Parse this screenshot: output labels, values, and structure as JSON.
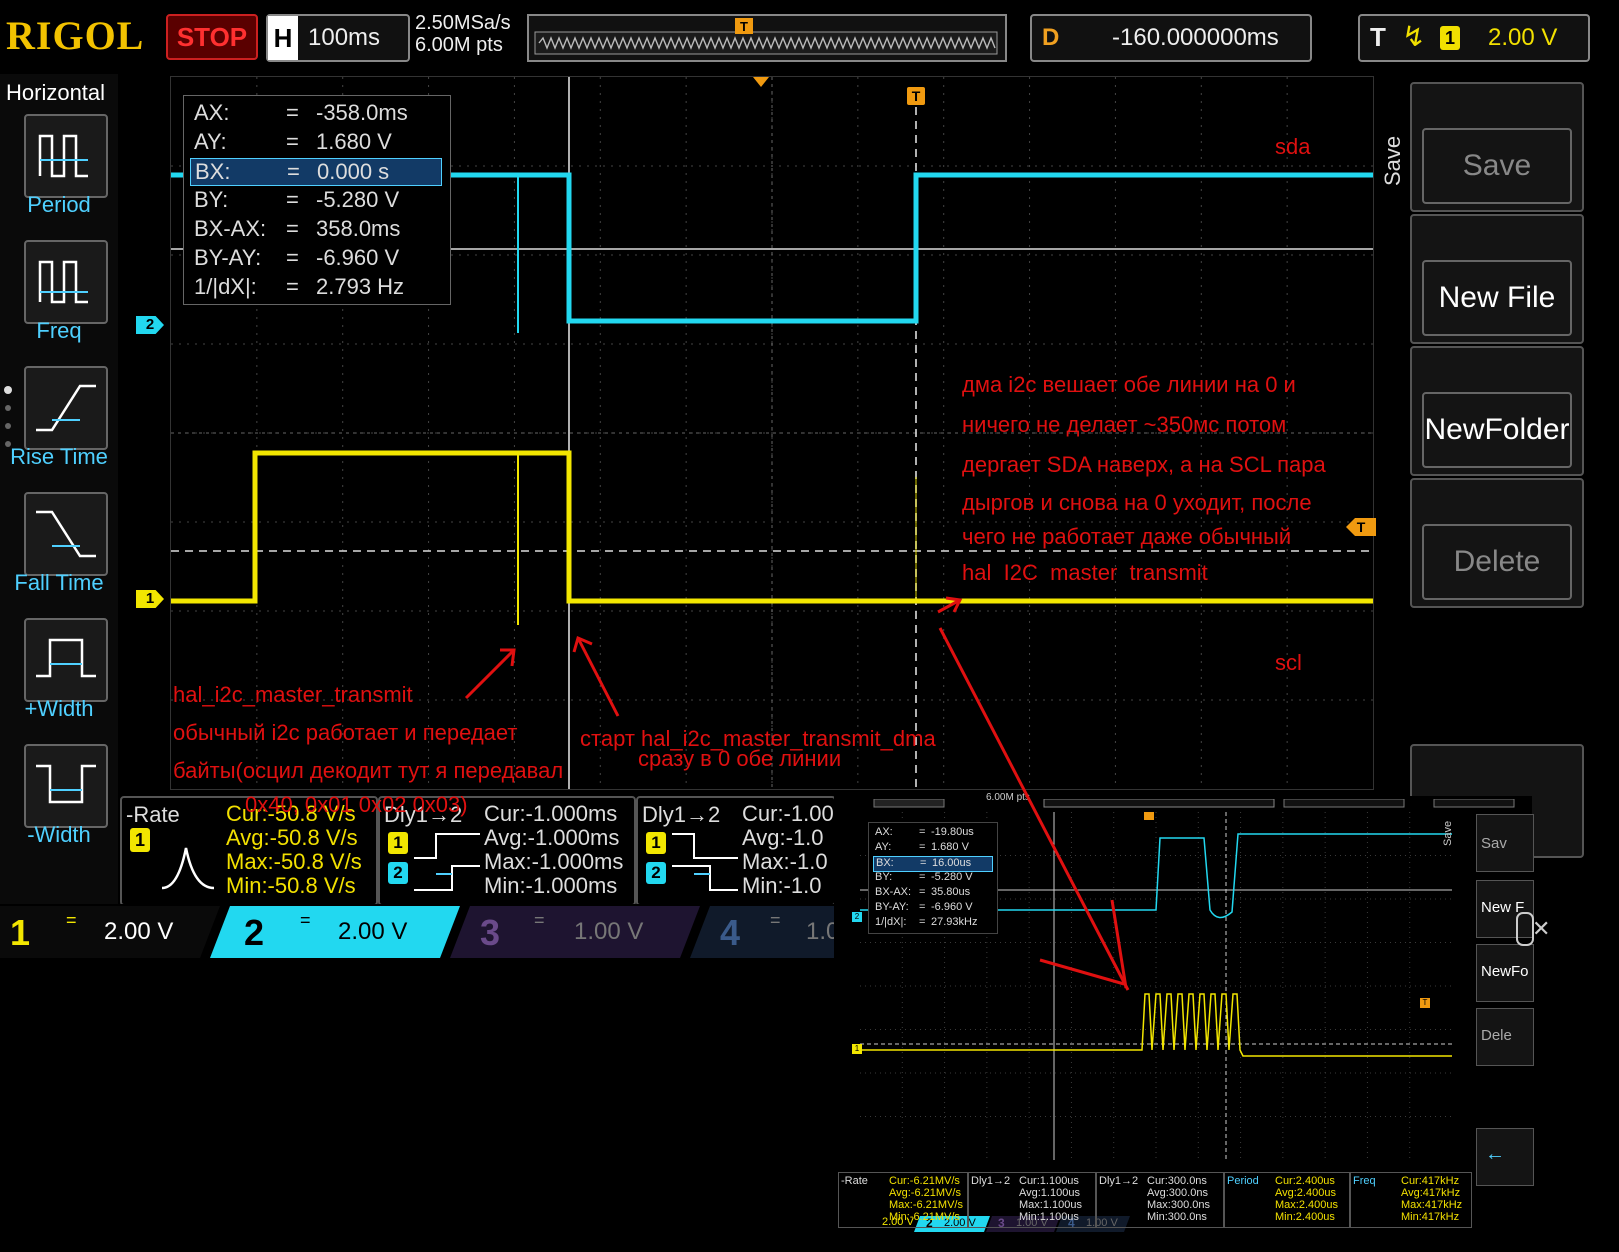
{
  "topbar": {
    "logo": "RIGOL",
    "run_state": "STOP",
    "h_key": "H",
    "timebase": "100ms",
    "sample_rate": "2.50MSa/s",
    "memory_depth": "6.00M pts",
    "d_key": "D",
    "delay": "-160.000000ms",
    "t_key": "T",
    "trigger_channel": "1",
    "trigger_level": "2.00 V"
  },
  "left_menu": {
    "title": "Horizontal",
    "items": [
      {
        "label": "Period"
      },
      {
        "label": "Freq"
      },
      {
        "label": "Rise Time"
      },
      {
        "label": "Fall Time"
      },
      {
        "label": "+Width"
      },
      {
        "label": "-Width"
      }
    ]
  },
  "cursors": {
    "rows": [
      {
        "k": "AX:",
        "v": "-358.0ms"
      },
      {
        "k": "AY:",
        "v": "1.680 V"
      },
      {
        "k": "BX:",
        "v": "0.000 s"
      },
      {
        "k": "BY:",
        "v": "-5.280 V"
      },
      {
        "k": "BX-AX:",
        "v": "358.0ms"
      },
      {
        "k": "BY-AY:",
        "v": "-6.960 V"
      },
      {
        "k": "1/|dX|:",
        "v": "2.793 Hz"
      }
    ],
    "eq": "="
  },
  "right_menu": {
    "title": "Save",
    "items": [
      {
        "label": "Save"
      },
      {
        "label": "New File"
      },
      {
        "label": "NewFolder"
      },
      {
        "label": "Delete"
      }
    ]
  },
  "measurements": [
    {
      "title": "-Rate",
      "ch": "1",
      "cur": "Cur:-50.8 V/s",
      "avg": "Avg:-50.8 V/s",
      "max": "Max:-50.8 V/s",
      "min": "Min:-50.8 V/s"
    },
    {
      "title": "Dly1→2",
      "ch": "1",
      "ch2": "2",
      "cur": "Cur:-1.000ms",
      "avg": "Avg:-1.000ms",
      "max": "Max:-1.000ms",
      "min": "Min:-1.000ms"
    },
    {
      "title": "Dly1→2",
      "ch": "1",
      "ch2": "2",
      "cur": "Cur:-1.00",
      "avg": "Avg:-1.0",
      "max": "Max:-1.0",
      "min": "Min:-1.0"
    }
  ],
  "channels": [
    {
      "num": "1",
      "scale": "2.00 V",
      "eq": "="
    },
    {
      "num": "2",
      "scale": "2.00 V",
      "eq": "="
    },
    {
      "num": "3",
      "scale": "1.00 V",
      "eq": "="
    },
    {
      "num": "4",
      "scale": "1.0",
      "eq": "="
    }
  ],
  "markers": {
    "ch1": "1",
    "ch2": "2",
    "trig": "T"
  },
  "annotations": {
    "sda": "sda",
    "scl": "scl",
    "dma_note": [
      "дма i2c вешает обе линии на 0 и",
      "ничего не делает ~350мс потом",
      "дергает SDA наверх, а на SCL пара",
      "дыргов и снова на 0 уходит, после",
      "чего не работает даже обычный",
      "hal_I2C_master_transmit"
    ],
    "hal_note": [
      "hal_i2c_master_transmit",
      "обычный i2c работает и передает",
      "байты(осцил декодит тут я передавал",
      "0x40, 0x01 0x02 0x03)"
    ],
    "dma_start": "старт hal_i2c_master_transmit_dma",
    "dma_start2": "сразу в 0 обе линии"
  },
  "inset": {
    "cursors": [
      {
        "k": "AX:",
        "v": "-19.80us"
      },
      {
        "k": "AY:",
        "v": "1.680 V"
      },
      {
        "k": "BX:",
        "v": "16.00us"
      },
      {
        "k": "BY:",
        "v": "-5.280 V"
      },
      {
        "k": "BX-AX:",
        "v": "35.80us"
      },
      {
        "k": "BY-AY:",
        "v": "-6.960 V"
      },
      {
        "k": "1/|dX|:",
        "v": "27.93kHz"
      }
    ],
    "eq": "=",
    "keys": [
      "Sav",
      "New F",
      "NewFo",
      "Dele"
    ],
    "save_label": "Save",
    "top_pts": "6.00M pts",
    "meas": [
      {
        "t": "-Rate",
        "a": "Cur:-6.21MV/s",
        "b": "Avg:-6.21MV/s",
        "c": "Max:-6.21MV/s",
        "d": "Min:-6.21MV/s"
      },
      {
        "t": "Dly1→2",
        "a": "Cur:1.100us",
        "b": "Avg:1.100us",
        "c": "Max:1.100us",
        "d": "Min:1.100us"
      },
      {
        "t": "Dly1→2",
        "a": "Cur:300.0ns",
        "b": "Avg:300.0ns",
        "c": "Max:300.0ns",
        "d": "Min:300.0ns"
      },
      {
        "t": "Period",
        "a": "Cur:2.400us",
        "b": "Avg:2.400us",
        "c": "Max:2.400us",
        "d": "Min:2.400us"
      },
      {
        "t": "Freq",
        "a": "Cur:417kHz",
        "b": "Avg:417kHz",
        "c": "Max:417kHz",
        "d": "Min:417kHz"
      }
    ],
    "ch_scale1": "2.00 V",
    "ch_scale2": "2.00 V",
    "ch_scale3": "1.00 V",
    "ch_scale4": "1.00 V",
    "ch_num2": "2",
    "ch_num3": "3",
    "ch_num4": "4"
  },
  "colors": {
    "ch1": "#f2e600",
    "ch2": "#22d8f0",
    "accent": "#e01010",
    "trigger": "#f09a10"
  }
}
